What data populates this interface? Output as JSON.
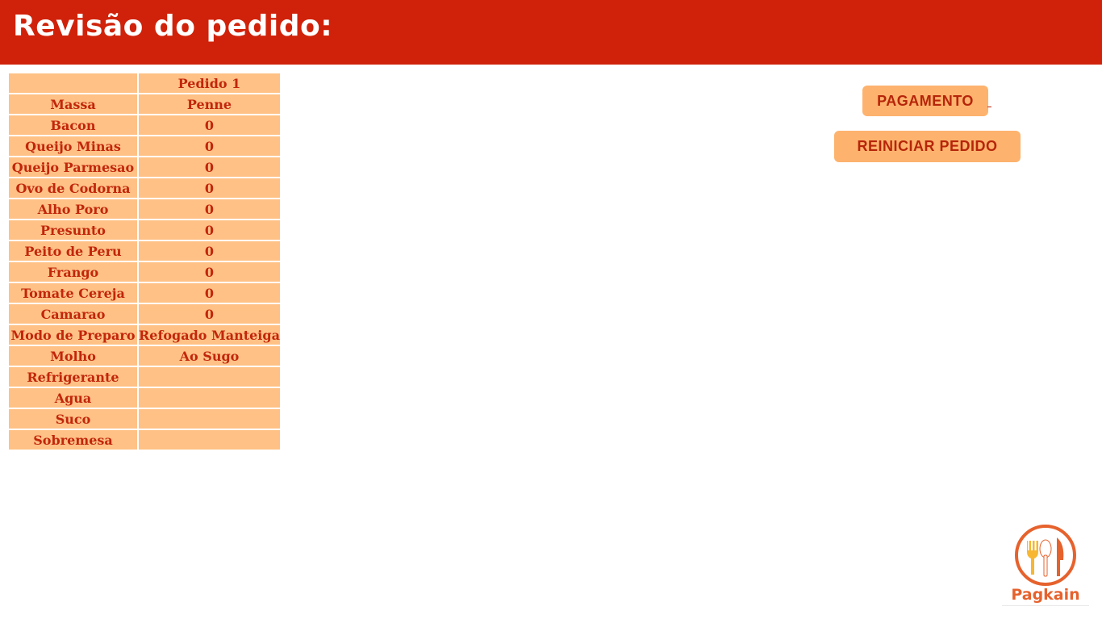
{
  "header": {
    "title": "Revisão do pedido:"
  },
  "order_table": {
    "column_header": "Pedido 1",
    "rows": [
      {
        "label": "Massa",
        "value": "Penne"
      },
      {
        "label": "Bacon",
        "value": "0"
      },
      {
        "label": "Queijo Minas",
        "value": "0"
      },
      {
        "label": "Queijo Parmesao",
        "value": "0"
      },
      {
        "label": "Ovo de Codorna",
        "value": "0"
      },
      {
        "label": "Alho Poro",
        "value": "0"
      },
      {
        "label": "Presunto",
        "value": "0"
      },
      {
        "label": "Peito de Peru",
        "value": "0"
      },
      {
        "label": "Frango",
        "value": "0"
      },
      {
        "label": "Tomate Cereja",
        "value": "0"
      },
      {
        "label": "Camarao",
        "value": "0"
      },
      {
        "label": "Modo de Preparo",
        "value": "Refogado Manteiga"
      },
      {
        "label": "Molho",
        "value": "Ao Sugo"
      },
      {
        "label": "Refrigerante",
        "value": ""
      },
      {
        "label": "Agua",
        "value": ""
      },
      {
        "label": "Suco",
        "value": ""
      },
      {
        "label": "Sobremesa",
        "value": ""
      }
    ]
  },
  "actions": {
    "payment_label": "PAGAMENTO",
    "reset_label": "REINICIAR PEDIDO"
  },
  "logo": {
    "text": "Pagkain",
    "icon": "fork-spoon-knife-icon"
  },
  "colors": {
    "header_bg": "#d0220a",
    "cell_bg": "#ffc185",
    "cell_text": "#c2260c",
    "button_bg": "#fdb36e",
    "logo_orange": "#e6622d",
    "logo_yellow": "#f7b733"
  }
}
